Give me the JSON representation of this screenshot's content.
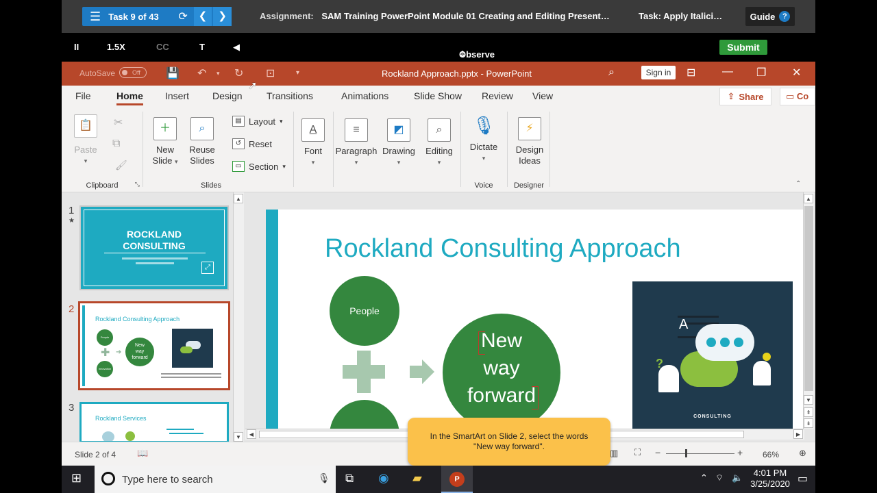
{
  "sam_bar": {
    "task_label": "Task 9 of 43",
    "assignment_label": "Assignment:",
    "assignment_title": "SAM Training PowerPoint Module 01 Creating and Editing Present…",
    "task_overlay": "Task: Apply Italici…",
    "guide_label": "Guide",
    "guide_icon": "?"
  },
  "controls": {
    "pause": "II",
    "speed": "1.5X",
    "cc": "CC",
    "text": "T",
    "volume": "◀",
    "mode": "Observe",
    "submit": "Submit"
  },
  "ppt_title": {
    "autosave": "AutoSave",
    "toggle": "Off",
    "document": "Rockland Approach.pptx - PowerPoint",
    "sign_in": "Sign in"
  },
  "menu": {
    "tabs": [
      "File",
      "Home",
      "Insert",
      "Design",
      "Transitions",
      "Animations",
      "Slide Show",
      "Review",
      "View"
    ],
    "share": "Share",
    "comments": "Co"
  },
  "ribbon": {
    "paste": "Paste",
    "clipboard": "Clipboard",
    "new_slide_1": "New",
    "new_slide_2": "Slide",
    "reuse_1": "Reuse",
    "reuse_2": "Slides",
    "layout": "Layout",
    "reset": "Reset",
    "section": "Section",
    "slides_group": "Slides",
    "font": "Font",
    "paragraph": "Paragraph",
    "drawing": "Drawing",
    "editing": "Editing",
    "dictate": "Dictate",
    "voice": "Voice",
    "design_ideas_1": "Design",
    "design_ideas_2": "Ideas",
    "designer": "Designer"
  },
  "thumbnails": {
    "nums": [
      "1",
      "2",
      "3"
    ],
    "slide1_title_1": "ROCKLAND",
    "slide1_title_2": "CONSULTING",
    "slide2_title": "Rockland Consulting Approach",
    "slide2_people": "People",
    "slide2_innovation": "Innovation",
    "slide2_new": "New",
    "slide2_way": "way",
    "slide2_forward": "forward",
    "slide3_title": "Rockland Services"
  },
  "slide": {
    "title": "Rockland Consulting Approach",
    "people": "People",
    "line1": "New",
    "line2": "way",
    "line3": "forward",
    "art_caption": "CONSULTING"
  },
  "tooltip": {
    "line1": "In the SmartArt on Slide 2, select the words",
    "line2": "\"New way forward\"."
  },
  "status": {
    "slide_info": "Slide 2 of 4",
    "zoom": "66%"
  },
  "taskbar": {
    "search_placeholder": "Type here to search",
    "time": "4:01 PM",
    "date": "3/25/2020"
  },
  "colors": {
    "ppt_accent": "#b7472a",
    "slide_teal": "#1eaac1",
    "smartart_green": "#34873e",
    "tooltip_yellow": "#fbc14a",
    "submit_green": "#2f9a3a"
  }
}
